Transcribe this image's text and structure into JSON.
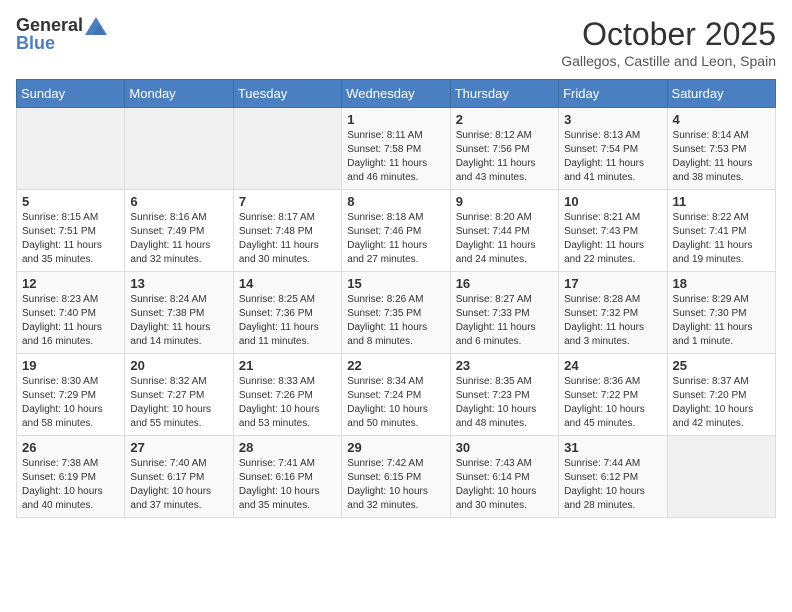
{
  "header": {
    "logo_general": "General",
    "logo_blue": "Blue",
    "month": "October 2025",
    "location": "Gallegos, Castille and Leon, Spain"
  },
  "weekdays": [
    "Sunday",
    "Monday",
    "Tuesday",
    "Wednesday",
    "Thursday",
    "Friday",
    "Saturday"
  ],
  "weeks": [
    [
      {
        "day": "",
        "info": ""
      },
      {
        "day": "",
        "info": ""
      },
      {
        "day": "",
        "info": ""
      },
      {
        "day": "1",
        "info": "Sunrise: 8:11 AM\nSunset: 7:58 PM\nDaylight: 11 hours and 46 minutes."
      },
      {
        "day": "2",
        "info": "Sunrise: 8:12 AM\nSunset: 7:56 PM\nDaylight: 11 hours and 43 minutes."
      },
      {
        "day": "3",
        "info": "Sunrise: 8:13 AM\nSunset: 7:54 PM\nDaylight: 11 hours and 41 minutes."
      },
      {
        "day": "4",
        "info": "Sunrise: 8:14 AM\nSunset: 7:53 PM\nDaylight: 11 hours and 38 minutes."
      }
    ],
    [
      {
        "day": "5",
        "info": "Sunrise: 8:15 AM\nSunset: 7:51 PM\nDaylight: 11 hours and 35 minutes."
      },
      {
        "day": "6",
        "info": "Sunrise: 8:16 AM\nSunset: 7:49 PM\nDaylight: 11 hours and 32 minutes."
      },
      {
        "day": "7",
        "info": "Sunrise: 8:17 AM\nSunset: 7:48 PM\nDaylight: 11 hours and 30 minutes."
      },
      {
        "day": "8",
        "info": "Sunrise: 8:18 AM\nSunset: 7:46 PM\nDaylight: 11 hours and 27 minutes."
      },
      {
        "day": "9",
        "info": "Sunrise: 8:20 AM\nSunset: 7:44 PM\nDaylight: 11 hours and 24 minutes."
      },
      {
        "day": "10",
        "info": "Sunrise: 8:21 AM\nSunset: 7:43 PM\nDaylight: 11 hours and 22 minutes."
      },
      {
        "day": "11",
        "info": "Sunrise: 8:22 AM\nSunset: 7:41 PM\nDaylight: 11 hours and 19 minutes."
      }
    ],
    [
      {
        "day": "12",
        "info": "Sunrise: 8:23 AM\nSunset: 7:40 PM\nDaylight: 11 hours and 16 minutes."
      },
      {
        "day": "13",
        "info": "Sunrise: 8:24 AM\nSunset: 7:38 PM\nDaylight: 11 hours and 14 minutes."
      },
      {
        "day": "14",
        "info": "Sunrise: 8:25 AM\nSunset: 7:36 PM\nDaylight: 11 hours and 11 minutes."
      },
      {
        "day": "15",
        "info": "Sunrise: 8:26 AM\nSunset: 7:35 PM\nDaylight: 11 hours and 8 minutes."
      },
      {
        "day": "16",
        "info": "Sunrise: 8:27 AM\nSunset: 7:33 PM\nDaylight: 11 hours and 6 minutes."
      },
      {
        "day": "17",
        "info": "Sunrise: 8:28 AM\nSunset: 7:32 PM\nDaylight: 11 hours and 3 minutes."
      },
      {
        "day": "18",
        "info": "Sunrise: 8:29 AM\nSunset: 7:30 PM\nDaylight: 11 hours and 1 minute."
      }
    ],
    [
      {
        "day": "19",
        "info": "Sunrise: 8:30 AM\nSunset: 7:29 PM\nDaylight: 10 hours and 58 minutes."
      },
      {
        "day": "20",
        "info": "Sunrise: 8:32 AM\nSunset: 7:27 PM\nDaylight: 10 hours and 55 minutes."
      },
      {
        "day": "21",
        "info": "Sunrise: 8:33 AM\nSunset: 7:26 PM\nDaylight: 10 hours and 53 minutes."
      },
      {
        "day": "22",
        "info": "Sunrise: 8:34 AM\nSunset: 7:24 PM\nDaylight: 10 hours and 50 minutes."
      },
      {
        "day": "23",
        "info": "Sunrise: 8:35 AM\nSunset: 7:23 PM\nDaylight: 10 hours and 48 minutes."
      },
      {
        "day": "24",
        "info": "Sunrise: 8:36 AM\nSunset: 7:22 PM\nDaylight: 10 hours and 45 minutes."
      },
      {
        "day": "25",
        "info": "Sunrise: 8:37 AM\nSunset: 7:20 PM\nDaylight: 10 hours and 42 minutes."
      }
    ],
    [
      {
        "day": "26",
        "info": "Sunrise: 7:38 AM\nSunset: 6:19 PM\nDaylight: 10 hours and 40 minutes."
      },
      {
        "day": "27",
        "info": "Sunrise: 7:40 AM\nSunset: 6:17 PM\nDaylight: 10 hours and 37 minutes."
      },
      {
        "day": "28",
        "info": "Sunrise: 7:41 AM\nSunset: 6:16 PM\nDaylight: 10 hours and 35 minutes."
      },
      {
        "day": "29",
        "info": "Sunrise: 7:42 AM\nSunset: 6:15 PM\nDaylight: 10 hours and 32 minutes."
      },
      {
        "day": "30",
        "info": "Sunrise: 7:43 AM\nSunset: 6:14 PM\nDaylight: 10 hours and 30 minutes."
      },
      {
        "day": "31",
        "info": "Sunrise: 7:44 AM\nSunset: 6:12 PM\nDaylight: 10 hours and 28 minutes."
      },
      {
        "day": "",
        "info": ""
      }
    ]
  ]
}
